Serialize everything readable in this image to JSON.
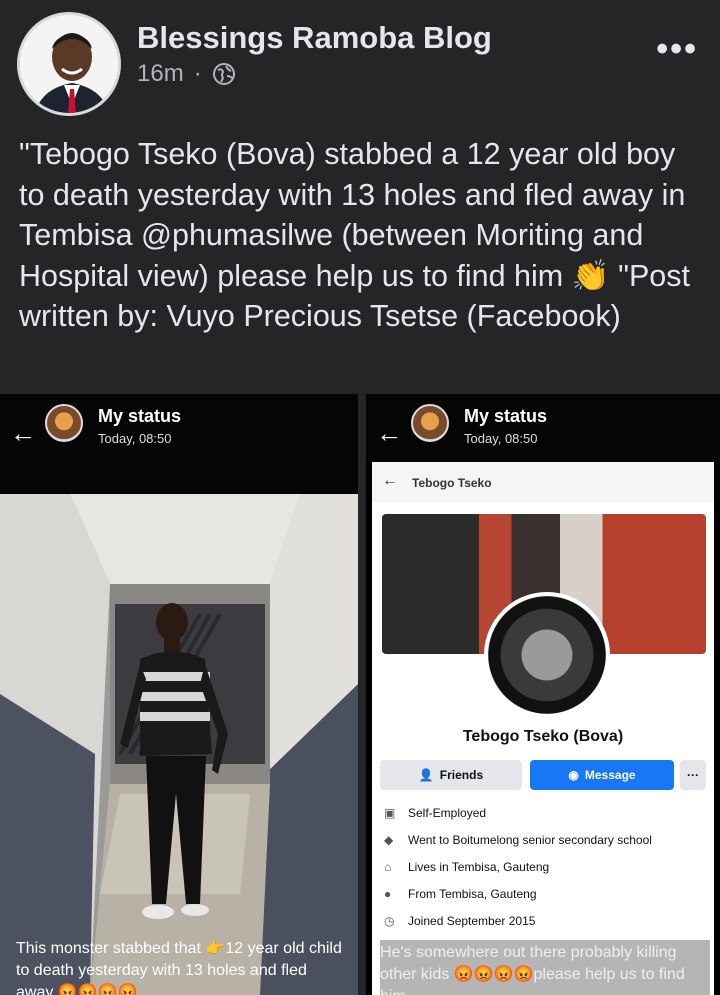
{
  "post": {
    "page_name": "Blessings Ramoba Blog",
    "time": "16m",
    "separator": "·",
    "text_before_emoji": "\"Tebogo Tseko (Bova) stabbed a 12 year old boy to death yesterday with 13 holes and fled away in Tembisa @phumasilwe (between Moriting and Hospital view) please help us to find him ",
    "emoji": "👏",
    "text_after_emoji": " \"Post written by: Vuyo Precious Tsetse (Facebook)"
  },
  "left_status": {
    "title": "My status",
    "time": "Today, 08:50",
    "caption_line1": "This monster stabbed that ",
    "caption_arrow": "👉",
    "caption_line1_end": "12 year old child",
    "caption_line2": "to death yesterday with 13 holes and fled",
    "caption_line3": "away 😡😡😡😡"
  },
  "right_status": {
    "title": "My status",
    "time": "Today, 08:50",
    "fb_header": "Tebogo Tseko",
    "profile_name": "Tebogo Tseko (Bova)",
    "friends_label": "Friends",
    "message_label": "Message",
    "more_label": "···",
    "info": [
      {
        "icon": "briefcase-icon",
        "text": "Self-Employed"
      },
      {
        "icon": "graduation-cap-icon",
        "text": "Went to Boitumelong senior secondary school"
      },
      {
        "icon": "home-icon",
        "text": "Lives in Tembisa, Gauteng"
      },
      {
        "icon": "location-pin-icon",
        "text": "From Tembisa, Gauteng"
      },
      {
        "icon": "clock-icon",
        "text": "Joined September 2015"
      }
    ],
    "caption": "He's somewhere out there probably killing other kids 😡😡😡😡please help us to find him"
  },
  "colors": {
    "background": "#242527",
    "text_primary": "#e4e6eb",
    "text_secondary": "#b0b3b8",
    "messenger_blue": "#1877f2"
  }
}
